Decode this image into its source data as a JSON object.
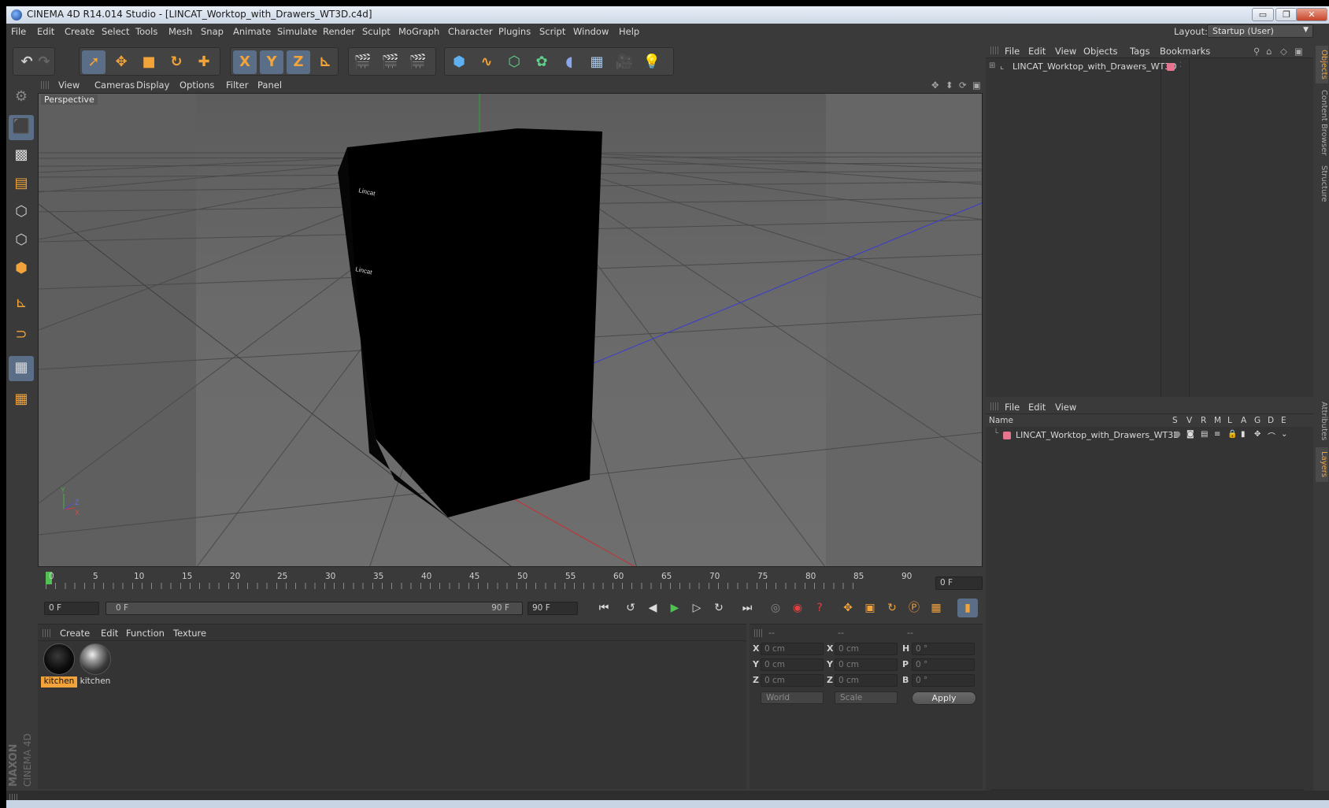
{
  "window": {
    "title": "CINEMA 4D R14.014 Studio - [LINCAT_Worktop_with_Drawers_WT3D.c4d]",
    "controls": {
      "minimize": "▭",
      "maximize": "❐",
      "close": "✕"
    }
  },
  "menubar": {
    "items": [
      "File",
      "Edit",
      "Create",
      "Select",
      "Tools",
      "Mesh",
      "Snap",
      "Animate",
      "Simulate",
      "Render",
      "Sculpt",
      "MoGraph",
      "Character",
      "Plugins",
      "Script",
      "Window",
      "Help"
    ],
    "layout_label": "Layout:",
    "layout_value": "Startup (User)"
  },
  "toolbar": {
    "axis_x": "X",
    "axis_y": "Y",
    "axis_z": "Z"
  },
  "viewport": {
    "menu": [
      "View",
      "Cameras",
      "Display",
      "Options",
      "Filter",
      "Panel"
    ],
    "camera_label": "Perspective",
    "brand_text_1": "Lincat",
    "brand_text_2": "Lincat",
    "axis_y": "Y",
    "axis_z": "Z",
    "axis_x": "X"
  },
  "timeline": {
    "ticks": [
      "0",
      "5",
      "10",
      "15",
      "20",
      "25",
      "30",
      "35",
      "40",
      "45",
      "50",
      "55",
      "60",
      "65",
      "70",
      "75",
      "80",
      "85",
      "90"
    ],
    "current_frame": "0 F"
  },
  "transport": {
    "start_field": "0 F",
    "range_start": "0 F",
    "range_end": "90 F",
    "end_field": "90 F"
  },
  "materials": {
    "menu": [
      "Create",
      "Edit",
      "Function",
      "Texture"
    ],
    "items": [
      {
        "label": "kitchen",
        "selected": true
      },
      {
        "label": "kitchen",
        "selected": false
      }
    ]
  },
  "coordinates": {
    "headers": [
      "--",
      "--",
      "--"
    ],
    "rows": [
      {
        "l1": "X",
        "v1": "0 cm",
        "l2": "X",
        "v2": "0 cm",
        "l3": "H",
        "v3": "0 °"
      },
      {
        "l1": "Y",
        "v1": "0 cm",
        "l2": "Y",
        "v2": "0 cm",
        "l3": "P",
        "v3": "0 °"
      },
      {
        "l1": "Z",
        "v1": "0 cm",
        "l2": "Z",
        "v2": "0 cm",
        "l3": "B",
        "v3": "0 °"
      }
    ],
    "space": "World",
    "mode": "Scale",
    "apply_label": "Apply"
  },
  "object_manager": {
    "menu": [
      "File",
      "Edit",
      "View",
      "Objects",
      "Tags",
      "Bookmarks"
    ],
    "objects": [
      {
        "name": "LINCAT_Worktop_with_Drawers_WT3D",
        "color": "#e8738f"
      }
    ]
  },
  "layer_manager": {
    "menu": [
      "File",
      "Edit",
      "View"
    ],
    "columns": [
      "Name",
      "S",
      "V",
      "R",
      "M",
      "L",
      "A",
      "G",
      "D",
      "E"
    ],
    "layers": [
      {
        "name": "LINCAT_Worktop_with_Drawers_WT3D",
        "color": "#e8738f"
      }
    ]
  },
  "side_tabs": [
    "Objects",
    "Content Browser",
    "Structure",
    "Attributes",
    "Layers"
  ],
  "branding": {
    "maxon": "MAXON",
    "product": "CINEMA 4D"
  },
  "colors": {
    "accent": "#f2a33a",
    "selection": "#5a6e88",
    "layer": "#e8738f"
  }
}
